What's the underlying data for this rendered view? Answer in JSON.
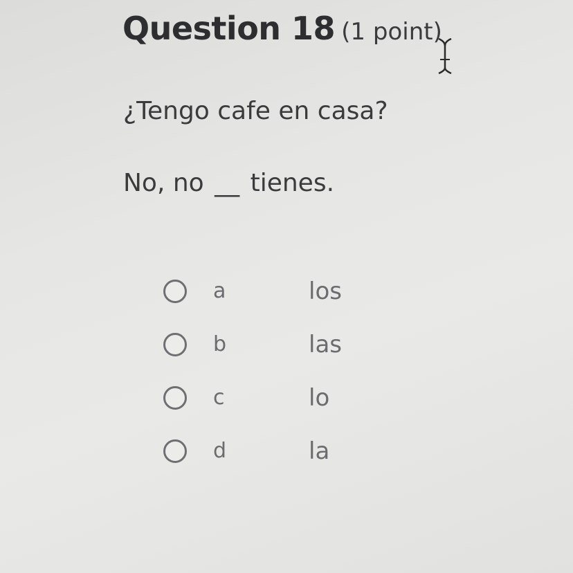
{
  "question": {
    "title": "Question 18",
    "points": "(1 point)",
    "prompt": "¿Tengo cafe en casa?",
    "sentence_before": "No, no",
    "blank": "__",
    "sentence_after": "tienes."
  },
  "options": [
    {
      "letter": "a",
      "text": "los"
    },
    {
      "letter": "b",
      "text": "las"
    },
    {
      "letter": "c",
      "text": "lo"
    },
    {
      "letter": "d",
      "text": "la"
    }
  ],
  "icons": {
    "cursor": "text-cursor-icon",
    "radio": "radio-unchecked-icon"
  },
  "colors": {
    "background": "#e5e5e3",
    "title": "#2d2e30",
    "text": "#3a3b3d",
    "option_text": "#6b6c6f",
    "radio_border": "#6e6f72"
  }
}
